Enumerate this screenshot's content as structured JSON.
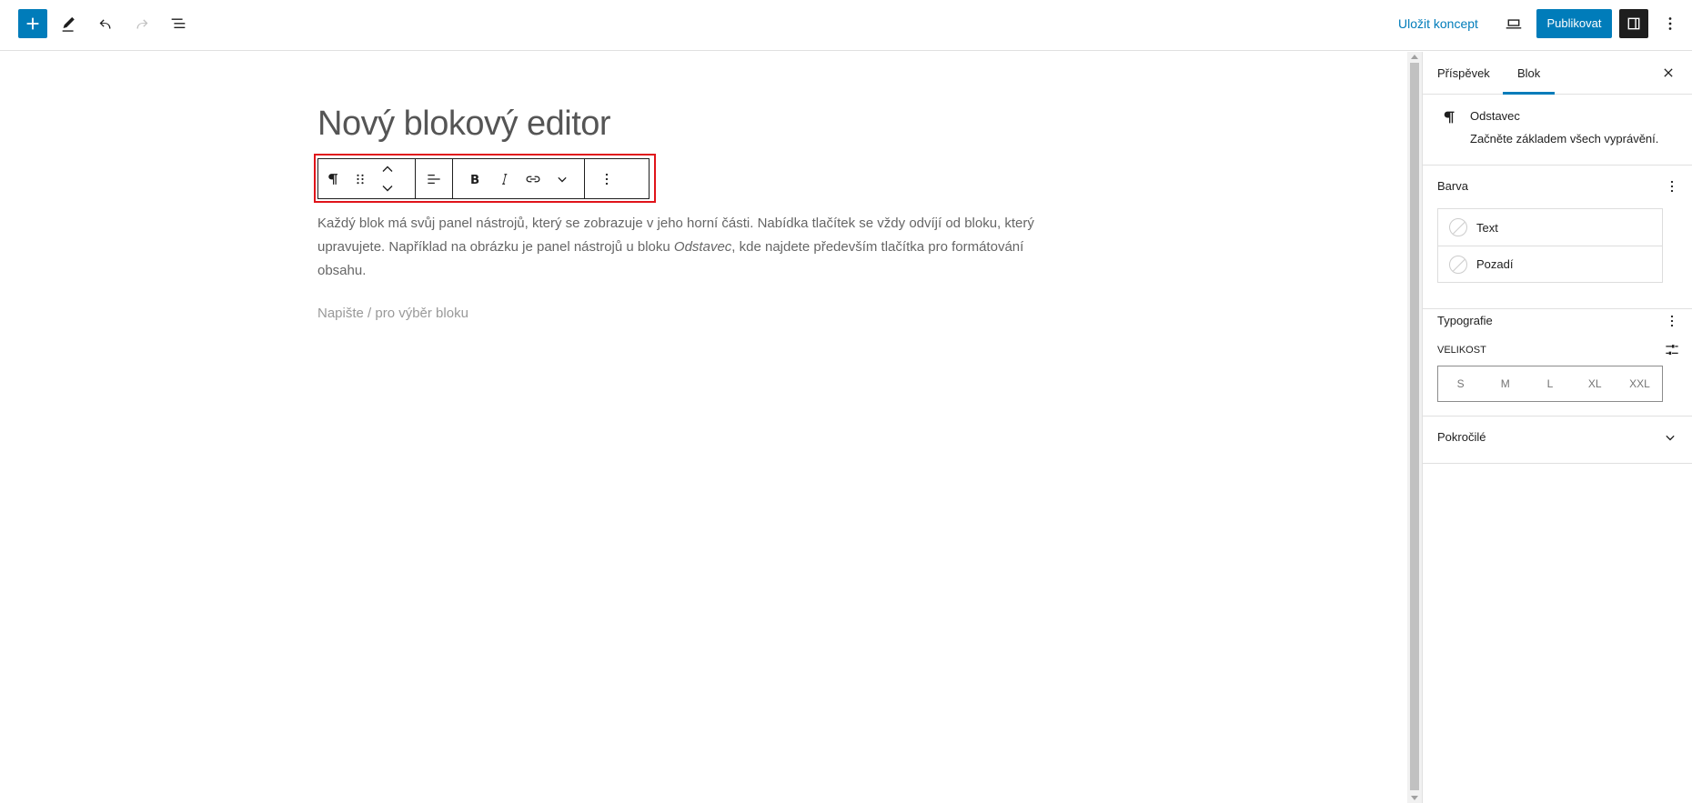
{
  "topbar": {
    "save_draft_label": "Uložit koncept",
    "publish_label": "Publikovat",
    "accent_color": "#007cba"
  },
  "editor": {
    "title": "Nový blokový editor",
    "paragraph_before_italic": "Každý blok má svůj panel nástrojů, který se zobrazuje v jeho horní části. Nabídka tlačítek se vždy odvíjí od bloku, který upravujete. Například na obrázku je panel nástrojů u bloku ",
    "paragraph_italic": "Odstavec",
    "paragraph_after_italic": ", kde najdete především tlačítka pro formátování obsahu.",
    "placeholder": "Napište / pro výběr bloku",
    "highlight_color": "#e0141a"
  },
  "block_toolbar": {
    "icons": [
      "paragraph-icon",
      "drag-handle-icon",
      "move-up-icon",
      "move-down-icon",
      "align-icon",
      "bold-icon",
      "italic-icon",
      "link-icon",
      "more-rich-text-icon",
      "options-icon"
    ]
  },
  "sidebar": {
    "tabs": [
      {
        "label": "Příspěvek"
      },
      {
        "label": "Blok"
      }
    ],
    "block_card": {
      "title": "Odstavec",
      "description": "Začněte základem všech vyprávění."
    },
    "color_panel": {
      "title": "Barva",
      "items": [
        {
          "label": "Text"
        },
        {
          "label": "Pozadí"
        }
      ]
    },
    "typography_panel": {
      "title": "Typografie",
      "size_label": "Velikost",
      "sizes": [
        "S",
        "M",
        "L",
        "XL",
        "XXL"
      ]
    },
    "advanced_panel": {
      "title": "Pokročilé"
    }
  }
}
